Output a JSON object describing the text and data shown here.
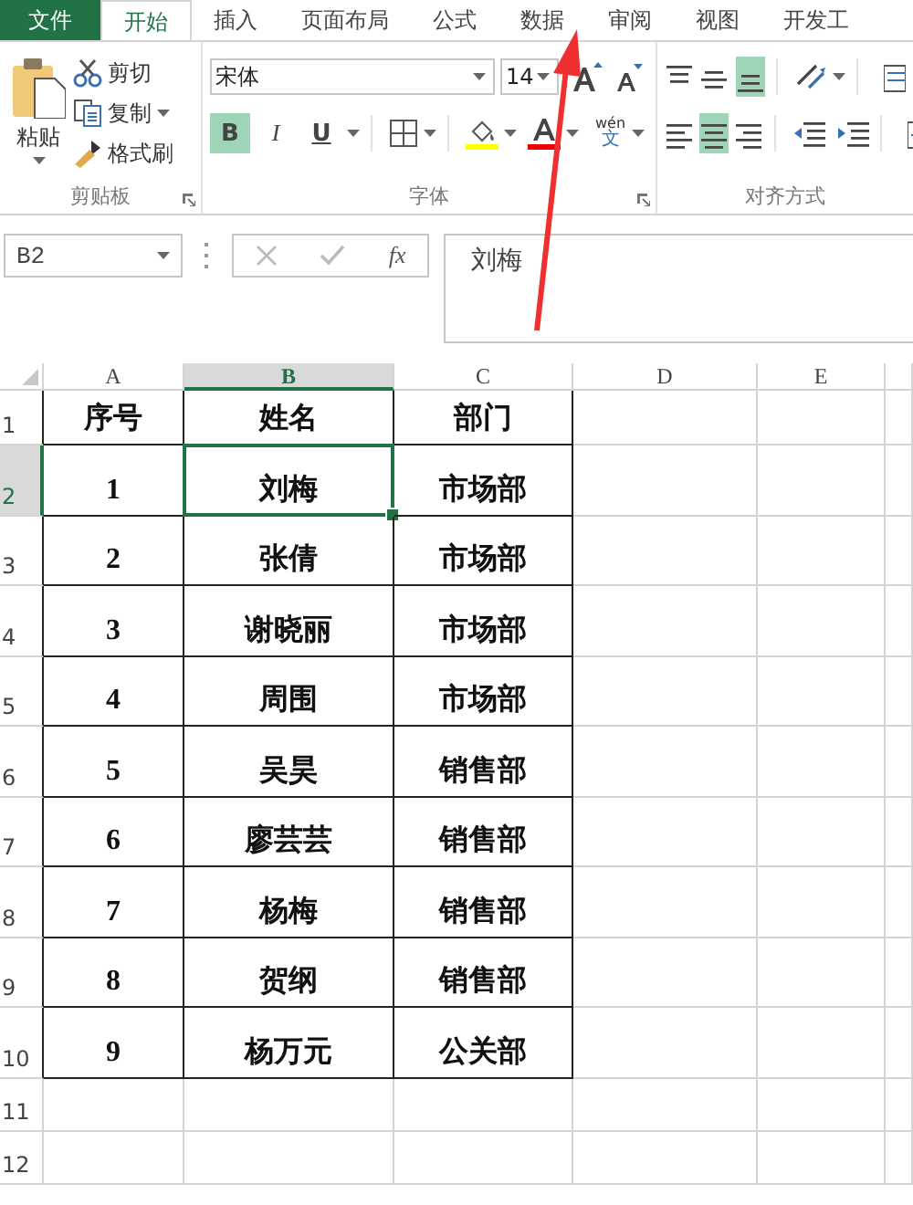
{
  "tabs": [
    {
      "label": "文件",
      "kind": "file",
      "selected": false
    },
    {
      "label": "开始",
      "kind": "tab",
      "selected": true
    },
    {
      "label": "插入",
      "kind": "tab",
      "selected": false
    },
    {
      "label": "页面布局",
      "kind": "tab",
      "selected": false
    },
    {
      "label": "公式",
      "kind": "tab",
      "selected": false
    },
    {
      "label": "数据",
      "kind": "tab",
      "selected": false
    },
    {
      "label": "审阅",
      "kind": "tab",
      "selected": false
    },
    {
      "label": "视图",
      "kind": "tab",
      "selected": false
    },
    {
      "label": "开发工",
      "kind": "tab",
      "selected": false
    }
  ],
  "clipboard": {
    "paste_label": "粘贴",
    "group_label": "剪贴板",
    "items": [
      {
        "label": "剪切",
        "kind": "cut",
        "dropdown": false
      },
      {
        "label": "复制",
        "kind": "copy",
        "dropdown": true
      },
      {
        "label": "格式刷",
        "kind": "brush",
        "dropdown": false
      }
    ]
  },
  "font": {
    "font_name": "宋体",
    "font_size": "14",
    "group_label": "字体",
    "phonetic_label": "wén",
    "phonetic_char": "文",
    "styles": [
      {
        "kind": "bold",
        "label": "B",
        "selected": true
      },
      {
        "kind": "italic",
        "label": "I",
        "selected": false
      },
      {
        "kind": "underline",
        "label": "U",
        "selected": false
      }
    ]
  },
  "alignment": {
    "group_label": "对齐方式",
    "vertical": [
      {
        "kind": "top",
        "selected": false
      },
      {
        "kind": "middle",
        "selected": false
      },
      {
        "kind": "bottom",
        "selected": true
      }
    ],
    "horizontal": [
      {
        "kind": "left",
        "selected": false
      },
      {
        "kind": "center",
        "selected": true
      },
      {
        "kind": "right",
        "selected": false
      }
    ]
  },
  "formula_bar": {
    "name_box": "B2",
    "function_label": "fx",
    "content": "刘梅"
  },
  "sheet": {
    "columns": [
      {
        "label": "A",
        "selected": false
      },
      {
        "label": "B",
        "selected": true
      },
      {
        "label": "C",
        "selected": false
      },
      {
        "label": "D",
        "selected": false
      },
      {
        "label": "E",
        "selected": false
      }
    ],
    "rows": [
      {
        "label": "1",
        "selected": false,
        "cells": [
          {
            "text": "序号",
            "selected": false
          },
          {
            "text": "姓名",
            "selected": false
          },
          {
            "text": "部门",
            "selected": false
          }
        ]
      },
      {
        "label": "2",
        "selected": true,
        "cells": [
          {
            "text": "1",
            "selected": false
          },
          {
            "text": "刘梅",
            "selected": true
          },
          {
            "text": "市场部",
            "selected": false
          }
        ]
      },
      {
        "label": "3",
        "selected": false,
        "cells": [
          {
            "text": "2",
            "selected": false
          },
          {
            "text": "张倩",
            "selected": false
          },
          {
            "text": "市场部",
            "selected": false
          }
        ]
      },
      {
        "label": "4",
        "selected": false,
        "cells": [
          {
            "text": "3",
            "selected": false
          },
          {
            "text": "谢晓丽",
            "selected": false
          },
          {
            "text": "市场部",
            "selected": false
          }
        ]
      },
      {
        "label": "5",
        "selected": false,
        "cells": [
          {
            "text": "4",
            "selected": false
          },
          {
            "text": "周围",
            "selected": false
          },
          {
            "text": "市场部",
            "selected": false
          }
        ]
      },
      {
        "label": "6",
        "selected": false,
        "cells": [
          {
            "text": "5",
            "selected": false
          },
          {
            "text": "吴昊",
            "selected": false
          },
          {
            "text": "销售部",
            "selected": false
          }
        ]
      },
      {
        "label": "7",
        "selected": false,
        "cells": [
          {
            "text": "6",
            "selected": false
          },
          {
            "text": "廖芸芸",
            "selected": false
          },
          {
            "text": "销售部",
            "selected": false
          }
        ]
      },
      {
        "label": "8",
        "selected": false,
        "cells": [
          {
            "text": "7",
            "selected": false
          },
          {
            "text": "杨梅",
            "selected": false
          },
          {
            "text": "销售部",
            "selected": false
          }
        ]
      },
      {
        "label": "9",
        "selected": false,
        "cells": [
          {
            "text": "8",
            "selected": false
          },
          {
            "text": "贺纲",
            "selected": false
          },
          {
            "text": "销售部",
            "selected": false
          }
        ]
      },
      {
        "label": "10",
        "selected": false,
        "cells": [
          {
            "text": "9",
            "selected": false
          },
          {
            "text": "杨万元",
            "selected": false
          },
          {
            "text": "公关部",
            "selected": false
          }
        ]
      },
      {
        "label": "11",
        "selected": false
      },
      {
        "label": "12",
        "selected": false
      }
    ]
  }
}
